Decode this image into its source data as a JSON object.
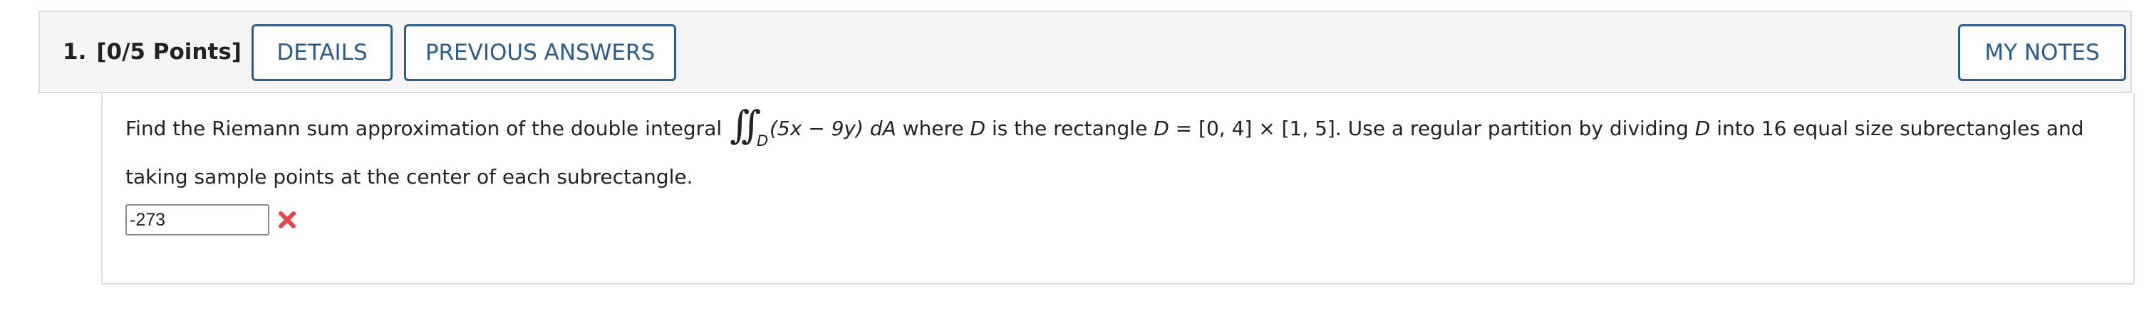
{
  "question": {
    "number": "1.",
    "points": "[0/5 Points]"
  },
  "buttons": {
    "details": "DETAILS",
    "previous_answers": "PREVIOUS ANSWERS",
    "my_notes": "MY NOTES"
  },
  "prompt": {
    "before_integral": "Find the Riemann sum approximation of the double integral ",
    "integral_domain": "D",
    "integrand": "(5x − 9y) dA",
    "where_text": " where ",
    "d_var": "D",
    "is_rect_text": " is the rectangle ",
    "rect_def": " = [0, 4] × [1, 5]. Use a regular partition by dividing ",
    "tail": " into 16 equal size subrectangles and taking sample points at the center of each subrectangle."
  },
  "answer": {
    "value": "-273",
    "status_icon": "incorrect-x-icon",
    "status_color": "#e0474c"
  },
  "colors": {
    "button_text": "#2b5d8c",
    "header_bg": "#f5f5f5"
  }
}
